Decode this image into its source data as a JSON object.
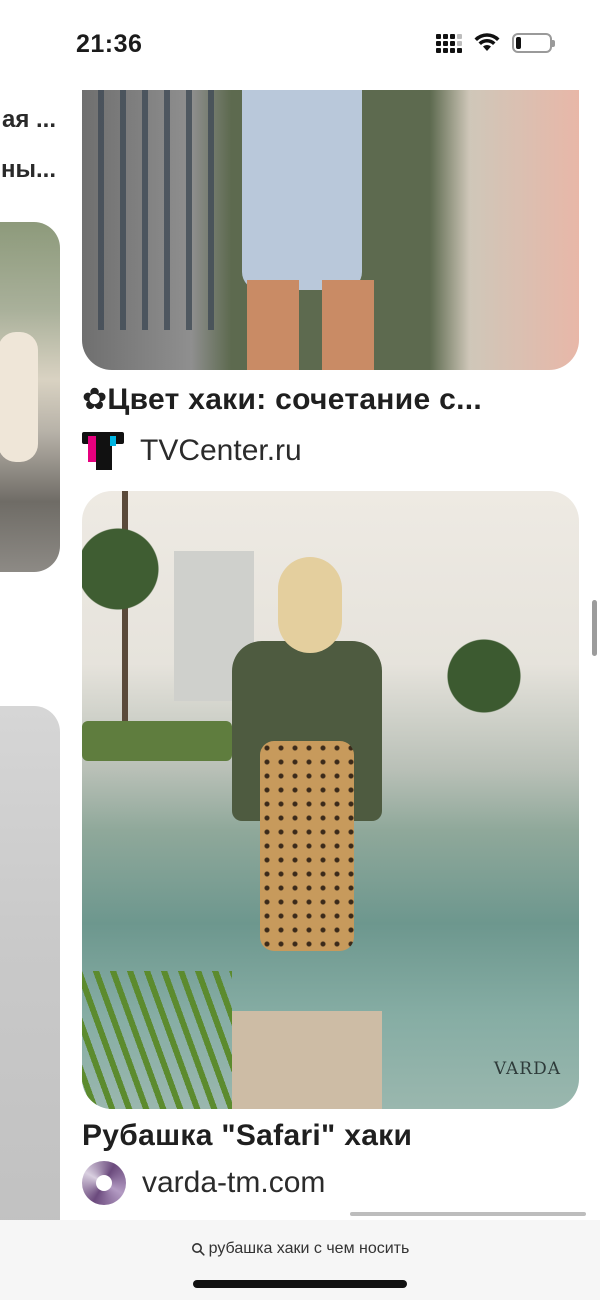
{
  "status_bar": {
    "time": "21:36",
    "battery_level": 0.15
  },
  "left_column": {
    "title_line_1": "ая ...",
    "title_line_2": "ны..."
  },
  "pins": [
    {
      "title": "✿Цвет хаки: сочетание с...",
      "source": "TVCenter.ru",
      "source_icon": "tvcenter-logo"
    },
    {
      "title": "Рубашка \"Safari\" хаки",
      "source": "varda-tm.com",
      "source_icon": "varda-logo",
      "image_watermark": "VARDA"
    }
  ],
  "bottom_bar": {
    "search_query": "рубашка хаки с чем носить"
  }
}
